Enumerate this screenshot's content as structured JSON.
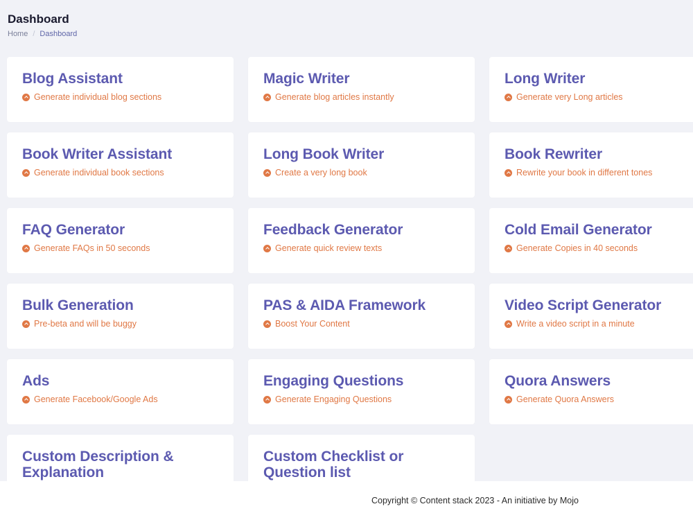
{
  "header": {
    "title": "Dashboard",
    "breadcrumb": {
      "home": "Home",
      "separator": "/",
      "current": "Dashboard"
    }
  },
  "colors": {
    "title": "#5c5ab0",
    "subtitle": "#e07845",
    "background": "#f1f2f7"
  },
  "icons": {
    "subtitle_icon": "chevron-up-circle-icon"
  },
  "cards": [
    {
      "title": "Blog Assistant",
      "subtitle": "Generate individual blog sections"
    },
    {
      "title": "Magic Writer",
      "subtitle": "Generate blog articles instantly"
    },
    {
      "title": "Long Writer",
      "subtitle": "Generate very Long articles"
    },
    {
      "title": "Book Writer Assistant",
      "subtitle": "Generate individual book sections"
    },
    {
      "title": "Long Book Writer",
      "subtitle": "Create a very long book"
    },
    {
      "title": "Book Rewriter",
      "subtitle": "Rewrite your book in different tones"
    },
    {
      "title": "FAQ Generator",
      "subtitle": "Generate FAQs in 50 seconds"
    },
    {
      "title": "Feedback Generator",
      "subtitle": "Generate quick review texts"
    },
    {
      "title": "Cold Email Generator",
      "subtitle": "Generate Copies in 40 seconds"
    },
    {
      "title": "Bulk Generation",
      "subtitle": "Pre-beta and will be buggy"
    },
    {
      "title": "PAS & AIDA Framework",
      "subtitle": "Boost Your Content"
    },
    {
      "title": "Video Script Generator",
      "subtitle": "Write a video script in a minute"
    },
    {
      "title": "Ads",
      "subtitle": "Generate Facebook/Google Ads"
    },
    {
      "title": "Engaging Questions",
      "subtitle": "Generate Engaging Questions"
    },
    {
      "title": "Quora Answers",
      "subtitle": "Generate Quora Answers"
    },
    {
      "title": "Custom Description & Explanation",
      "subtitle": ""
    },
    {
      "title": "Custom Checklist or Question list",
      "subtitle": ""
    }
  ],
  "footer": {
    "text": "Copyright © Content stack 2023 - An initiative by Mojo"
  }
}
